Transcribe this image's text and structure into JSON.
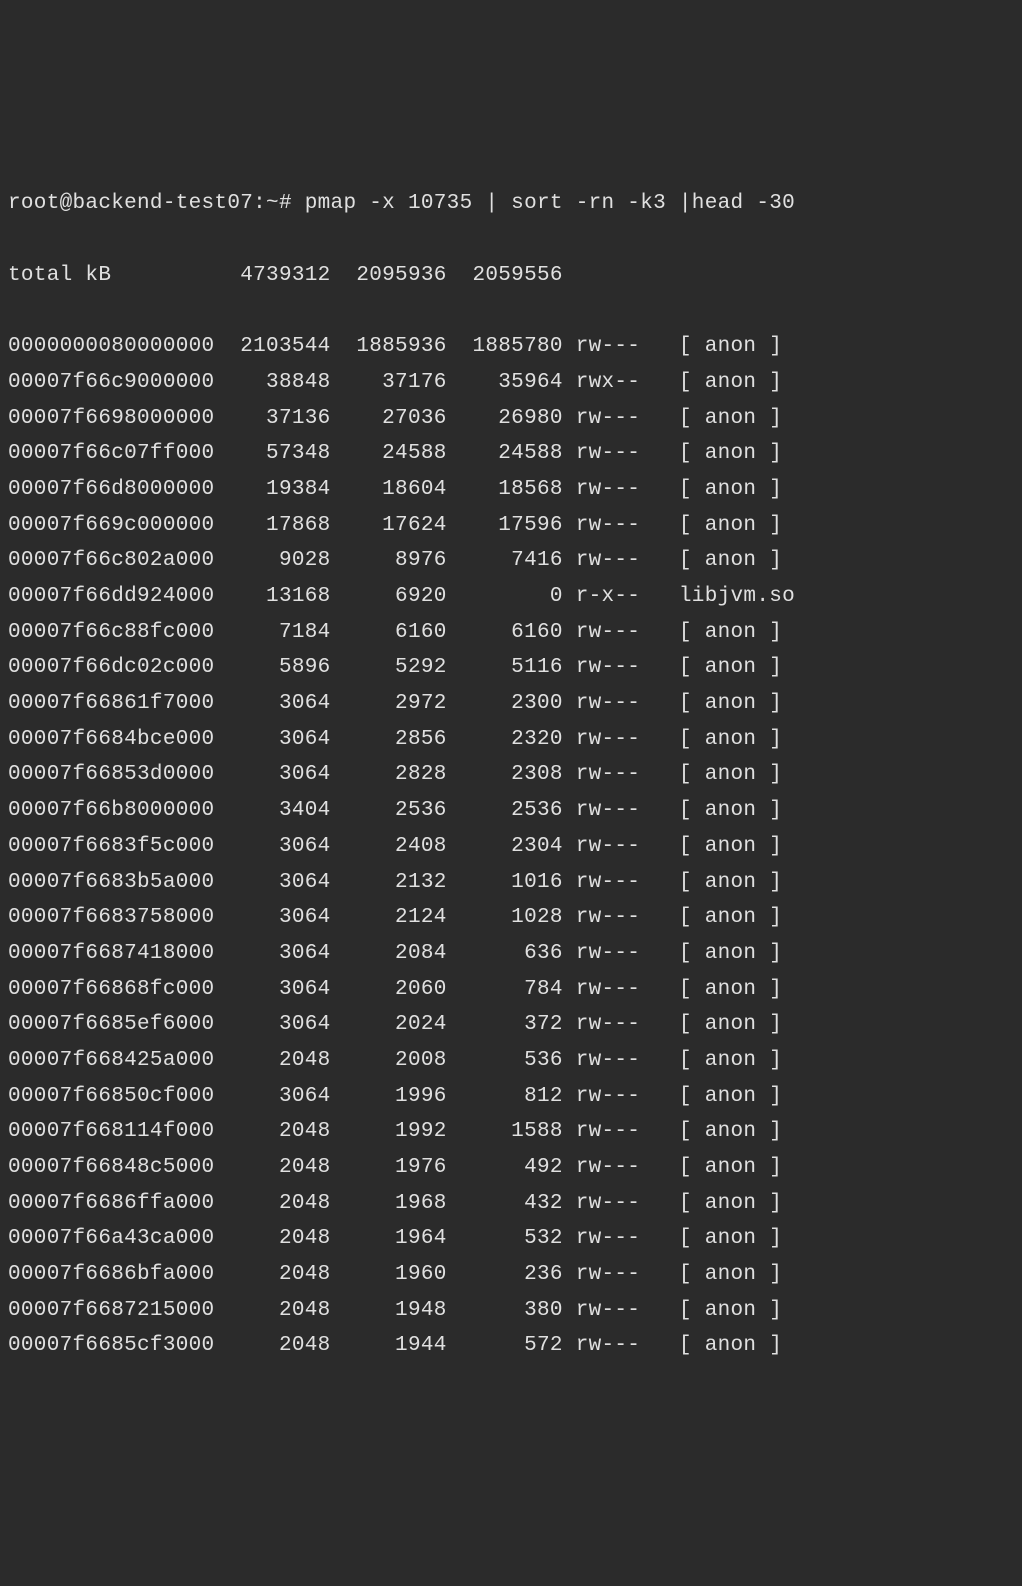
{
  "prompt": "root@backend-test07:~# ",
  "command": "pmap -x 10735 | sort -rn -k3 |head -30",
  "total_label": "total kB",
  "total_kbytes": "4739312",
  "total_rss": "2095936",
  "total_dirty": "2059556",
  "rows": [
    {
      "addr": "0000000080000000",
      "kbytes": "2103544",
      "rss": "1885936",
      "dirty": "1885780",
      "mode": "rw---",
      "mapping": "[ anon ]"
    },
    {
      "addr": "00007f66c9000000",
      "kbytes": "38848",
      "rss": "37176",
      "dirty": "35964",
      "mode": "rwx--",
      "mapping": "[ anon ]"
    },
    {
      "addr": "00007f6698000000",
      "kbytes": "37136",
      "rss": "27036",
      "dirty": "26980",
      "mode": "rw---",
      "mapping": "[ anon ]"
    },
    {
      "addr": "00007f66c07ff000",
      "kbytes": "57348",
      "rss": "24588",
      "dirty": "24588",
      "mode": "rw---",
      "mapping": "[ anon ]"
    },
    {
      "addr": "00007f66d8000000",
      "kbytes": "19384",
      "rss": "18604",
      "dirty": "18568",
      "mode": "rw---",
      "mapping": "[ anon ]"
    },
    {
      "addr": "00007f669c000000",
      "kbytes": "17868",
      "rss": "17624",
      "dirty": "17596",
      "mode": "rw---",
      "mapping": "[ anon ]"
    },
    {
      "addr": "00007f66c802a000",
      "kbytes": "9028",
      "rss": "8976",
      "dirty": "7416",
      "mode": "rw---",
      "mapping": "[ anon ]"
    },
    {
      "addr": "00007f66dd924000",
      "kbytes": "13168",
      "rss": "6920",
      "dirty": "0",
      "mode": "r-x--",
      "mapping": "libjvm.so"
    },
    {
      "addr": "00007f66c88fc000",
      "kbytes": "7184",
      "rss": "6160",
      "dirty": "6160",
      "mode": "rw---",
      "mapping": "[ anon ]"
    },
    {
      "addr": "00007f66dc02c000",
      "kbytes": "5896",
      "rss": "5292",
      "dirty": "5116",
      "mode": "rw---",
      "mapping": "[ anon ]"
    },
    {
      "addr": "00007f66861f7000",
      "kbytes": "3064",
      "rss": "2972",
      "dirty": "2300",
      "mode": "rw---",
      "mapping": "[ anon ]"
    },
    {
      "addr": "00007f6684bce000",
      "kbytes": "3064",
      "rss": "2856",
      "dirty": "2320",
      "mode": "rw---",
      "mapping": "[ anon ]"
    },
    {
      "addr": "00007f66853d0000",
      "kbytes": "3064",
      "rss": "2828",
      "dirty": "2308",
      "mode": "rw---",
      "mapping": "[ anon ]"
    },
    {
      "addr": "00007f66b8000000",
      "kbytes": "3404",
      "rss": "2536",
      "dirty": "2536",
      "mode": "rw---",
      "mapping": "[ anon ]"
    },
    {
      "addr": "00007f6683f5c000",
      "kbytes": "3064",
      "rss": "2408",
      "dirty": "2304",
      "mode": "rw---",
      "mapping": "[ anon ]"
    },
    {
      "addr": "00007f6683b5a000",
      "kbytes": "3064",
      "rss": "2132",
      "dirty": "1016",
      "mode": "rw---",
      "mapping": "[ anon ]"
    },
    {
      "addr": "00007f6683758000",
      "kbytes": "3064",
      "rss": "2124",
      "dirty": "1028",
      "mode": "rw---",
      "mapping": "[ anon ]"
    },
    {
      "addr": "00007f6687418000",
      "kbytes": "3064",
      "rss": "2084",
      "dirty": "636",
      "mode": "rw---",
      "mapping": "[ anon ]"
    },
    {
      "addr": "00007f66868fc000",
      "kbytes": "3064",
      "rss": "2060",
      "dirty": "784",
      "mode": "rw---",
      "mapping": "[ anon ]"
    },
    {
      "addr": "00007f6685ef6000",
      "kbytes": "3064",
      "rss": "2024",
      "dirty": "372",
      "mode": "rw---",
      "mapping": "[ anon ]"
    },
    {
      "addr": "00007f668425a000",
      "kbytes": "2048",
      "rss": "2008",
      "dirty": "536",
      "mode": "rw---",
      "mapping": "[ anon ]"
    },
    {
      "addr": "00007f66850cf000",
      "kbytes": "3064",
      "rss": "1996",
      "dirty": "812",
      "mode": "rw---",
      "mapping": "[ anon ]"
    },
    {
      "addr": "00007f668114f000",
      "kbytes": "2048",
      "rss": "1992",
      "dirty": "1588",
      "mode": "rw---",
      "mapping": "[ anon ]"
    },
    {
      "addr": "00007f66848c5000",
      "kbytes": "2048",
      "rss": "1976",
      "dirty": "492",
      "mode": "rw---",
      "mapping": "[ anon ]"
    },
    {
      "addr": "00007f6686ffa000",
      "kbytes": "2048",
      "rss": "1968",
      "dirty": "432",
      "mode": "rw---",
      "mapping": "[ anon ]"
    },
    {
      "addr": "00007f66a43ca000",
      "kbytes": "2048",
      "rss": "1964",
      "dirty": "532",
      "mode": "rw---",
      "mapping": "[ anon ]"
    },
    {
      "addr": "00007f6686bfa000",
      "kbytes": "2048",
      "rss": "1960",
      "dirty": "236",
      "mode": "rw---",
      "mapping": "[ anon ]"
    },
    {
      "addr": "00007f6687215000",
      "kbytes": "2048",
      "rss": "1948",
      "dirty": "380",
      "mode": "rw---",
      "mapping": "[ anon ]"
    },
    {
      "addr": "00007f6685cf3000",
      "kbytes": "2048",
      "rss": "1944",
      "dirty": "572",
      "mode": "rw---",
      "mapping": "[ anon ]"
    }
  ],
  "col_widths": {
    "addr": 16,
    "kbytes": 8,
    "rss": 8,
    "dirty": 8,
    "mode": 6,
    "mapping_lead": 2
  }
}
